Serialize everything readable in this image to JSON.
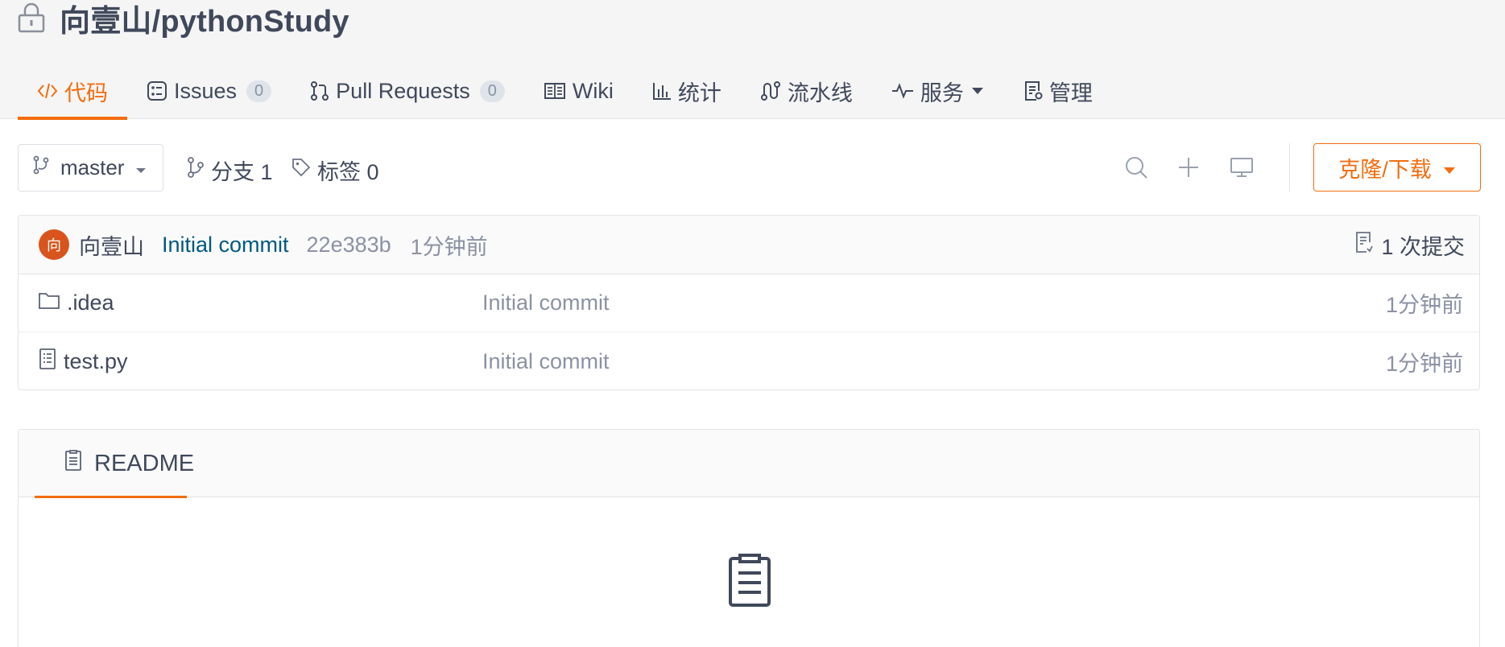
{
  "repo": {
    "name": "向壹山/pythonStudy",
    "lock_icon": "lock-icon"
  },
  "tabs": [
    {
      "id": "code",
      "label": "代码",
      "icon": "code-icon",
      "active": true
    },
    {
      "id": "issues",
      "label": "Issues",
      "badge": "0",
      "icon": "issues-icon"
    },
    {
      "id": "pulls",
      "label": "Pull Requests",
      "badge": "0",
      "icon": "pull-request-icon"
    },
    {
      "id": "wiki",
      "label": "Wiki",
      "icon": "book-icon"
    },
    {
      "id": "stats",
      "label": "统计",
      "icon": "bar-chart-icon"
    },
    {
      "id": "pipeline",
      "label": "流水线",
      "icon": "pipeline-icon"
    },
    {
      "id": "services",
      "label": "服务",
      "icon": "pulse-icon"
    },
    {
      "id": "manage",
      "label": "管理",
      "icon": "settings-doc-icon"
    }
  ],
  "toolbar": {
    "branch": "master",
    "branches_label": "分支 1",
    "tags_label": "标签 0",
    "clone_label": "克隆/下载"
  },
  "commit": {
    "avatar_char": "向",
    "author": "向壹山",
    "message": "Initial commit",
    "sha": "22e383b",
    "time": "1分钟前",
    "count_label": "1 次提交"
  },
  "files": [
    {
      "name": ".idea",
      "type": "folder",
      "message": "Initial commit",
      "time": "1分钟前"
    },
    {
      "name": "test.py",
      "type": "file",
      "message": "Initial commit",
      "time": "1分钟前"
    }
  ],
  "readme": {
    "tab_label": "README"
  },
  "colors": {
    "accent": "#f36d0f",
    "text": "#40485b",
    "muted": "#8c92a4",
    "link": "#005980",
    "avatar": "#d9541c"
  }
}
